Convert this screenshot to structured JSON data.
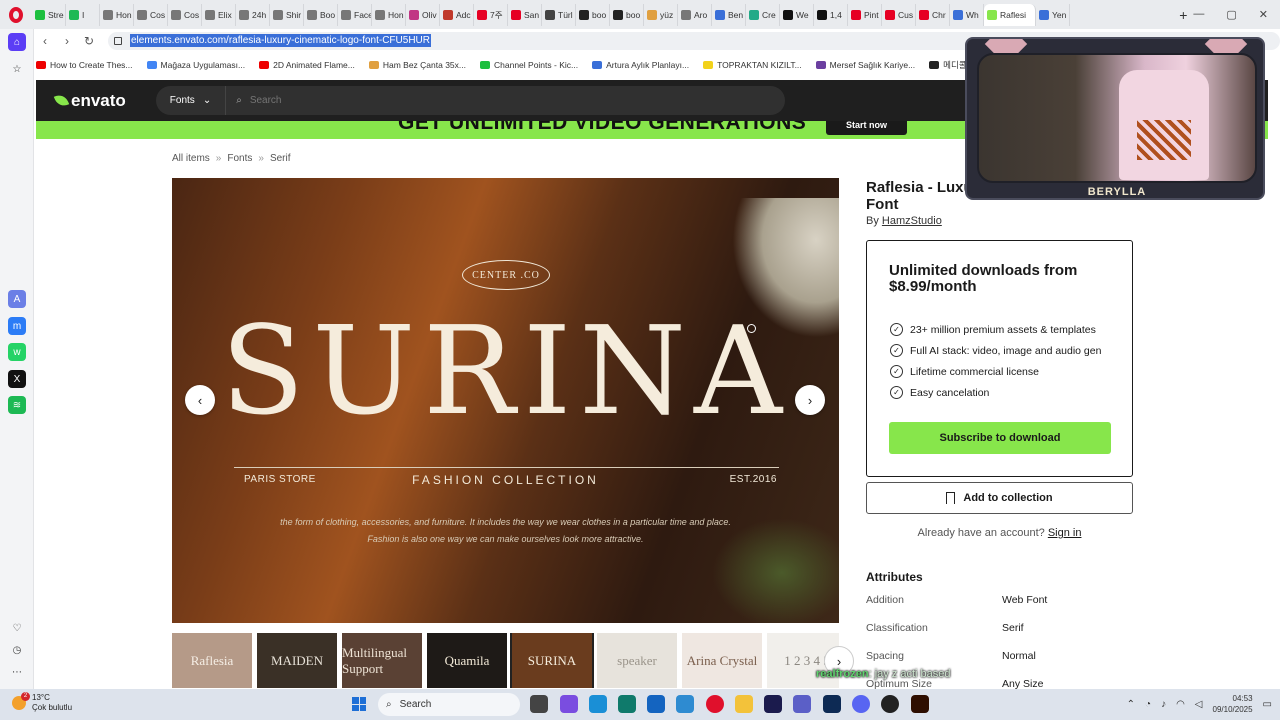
{
  "browser": {
    "tabs": [
      {
        "label": "Stre",
        "color": "#1dbf3f"
      },
      {
        "label": "I",
        "color": "#1db954"
      },
      {
        "label": "Hon",
        "color": "#777777"
      },
      {
        "label": "Cos",
        "color": "#777777"
      },
      {
        "label": "Cos",
        "color": "#777777"
      },
      {
        "label": "Elix",
        "color": "#777777"
      },
      {
        "label": "24h",
        "color": "#777777"
      },
      {
        "label": "Shir",
        "color": "#777777"
      },
      {
        "label": "Boo",
        "color": "#777777"
      },
      {
        "label": "Face",
        "color": "#777777"
      },
      {
        "label": "Hon",
        "color": "#777777"
      },
      {
        "label": "Oliv",
        "color": "#c13584"
      },
      {
        "label": "Adc",
        "color": "#c0392b"
      },
      {
        "label": "7주",
        "color": "#e60023"
      },
      {
        "label": "San",
        "color": "#e60023"
      },
      {
        "label": "Türl",
        "color": "#444444"
      },
      {
        "label": "boo",
        "color": "#222222"
      },
      {
        "label": "boo",
        "color": "#222222"
      },
      {
        "label": "yüz",
        "color": "#e0a040"
      },
      {
        "label": "Aro",
        "color": "#777777"
      },
      {
        "label": "Ben",
        "color": "#3a6fd8"
      },
      {
        "label": "Cre",
        "color": "#22aa88"
      },
      {
        "label": "We",
        "color": "#111111"
      },
      {
        "label": "1,4",
        "color": "#111111"
      },
      {
        "label": "Pint",
        "color": "#e60023"
      },
      {
        "label": "Cus",
        "color": "#e60023"
      },
      {
        "label": "Chr",
        "color": "#e60023"
      },
      {
        "label": "Wh",
        "color": "#3a6fd8"
      },
      {
        "label": "Raflesi",
        "color": "#87e64b",
        "active": true
      },
      {
        "label": "Yen",
        "color": "#3a6fd8"
      }
    ],
    "url": "elements.envato.com/raflesia-luxury-cinematic-logo-font-CFU5HUR",
    "bookmarks": [
      {
        "label": "How to Create Thes...",
        "color": "#e00"
      },
      {
        "label": "Mağaza Uygulaması...",
        "color": "#4285f4"
      },
      {
        "label": "2D Animated Flame...",
        "color": "#e00"
      },
      {
        "label": "Ham Bez Çanta 35x...",
        "color": "#e0a040"
      },
      {
        "label": "Channel Points - Kic...",
        "color": "#1dbf3f"
      },
      {
        "label": "Artura Aylık Planlayı...",
        "color": "#3a6fd8"
      },
      {
        "label": "TOPRAKTAN KIZILT...",
        "color": "#f2d21b"
      },
      {
        "label": "Mersef Sağlık Kariye...",
        "color": "#6b3fa0"
      },
      {
        "label": "메디콜라위",
        "color": "#222"
      }
    ]
  },
  "envato": {
    "logo": "envato",
    "category_dropdown": "Fonts",
    "search_placeholder": "Search",
    "promo_text": "GET UNLIMITED VIDEO GENERATIONS",
    "promo_button": "Start now",
    "breadcrumb": [
      "All items",
      "Fonts",
      "Serif"
    ],
    "hero": {
      "badge": "CENTER .CO",
      "title": "SURINA",
      "left_text": "PARIS STORE",
      "center_text": "FASHION COLLECTION",
      "right_text": "EST.2016",
      "desc_line1": "the form of clothing, accessories, and furniture. It includes the way we wear clothes in a particular time and place.",
      "desc_line2": "Fashion is also one way we can make ourselves look more attractive."
    },
    "thumbnails": [
      {
        "text": "Raflesia",
        "bg": "#b59a88",
        "fg": "#f6efe6"
      },
      {
        "text": "MAIDEN",
        "bg": "#3a3026",
        "fg": "#e8e2d8"
      },
      {
        "text": "Multilingual Support",
        "bg": "#5a4134",
        "fg": "#efe4d6"
      },
      {
        "text": "Quamila",
        "bg": "#1e1a17",
        "fg": "#f3ead8"
      },
      {
        "text": "SURINA",
        "bg": "#6a3c1e",
        "fg": "#f5ecdc"
      },
      {
        "text": "speaker",
        "bg": "#e7e3dc",
        "fg": "#9a948a"
      },
      {
        "text": "Arina Crystal",
        "bg": "#efe7e1",
        "fg": "#7a5e4c"
      },
      {
        "text": "1 2 3 4 5",
        "bg": "#f1efeb",
        "fg": "#8a867f"
      }
    ],
    "product": {
      "title": "Raflesia - Luxury Cinematic Logo Font",
      "author_prefix": "By",
      "author": "HamzStudio"
    },
    "subscription": {
      "title": "Unlimited downloads from $8.99/month",
      "features": [
        "23+ million premium assets & templates",
        "Full AI stack: video, image and audio gen",
        "Lifetime commercial license",
        "Easy cancelation"
      ],
      "cta": "Subscribe to download"
    },
    "add_collection": "Add to collection",
    "signin_prompt": "Already have an account?",
    "signin_link": "Sign in",
    "attributes_heading": "Attributes",
    "attributes": [
      {
        "key": "Addition",
        "value": "Web Font"
      },
      {
        "key": "Classification",
        "value": "Serif"
      },
      {
        "key": "Spacing",
        "value": "Normal"
      },
      {
        "key": "Optimum Size",
        "value": "Any Size"
      }
    ]
  },
  "overlay": {
    "webcam_label": "BERYLLA",
    "chat_user": "realfrozen",
    "chat_message": ": jay z acti based"
  },
  "taskbar": {
    "weather_temp": "13°C",
    "weather_desc": "Çok bulutlu",
    "weather_badge": "2",
    "search_label": "Search",
    "time": "04:53",
    "date": "09/10/2025"
  },
  "colors": {
    "accent": "#87e64b",
    "nav_bg": "#1f1f1f"
  }
}
